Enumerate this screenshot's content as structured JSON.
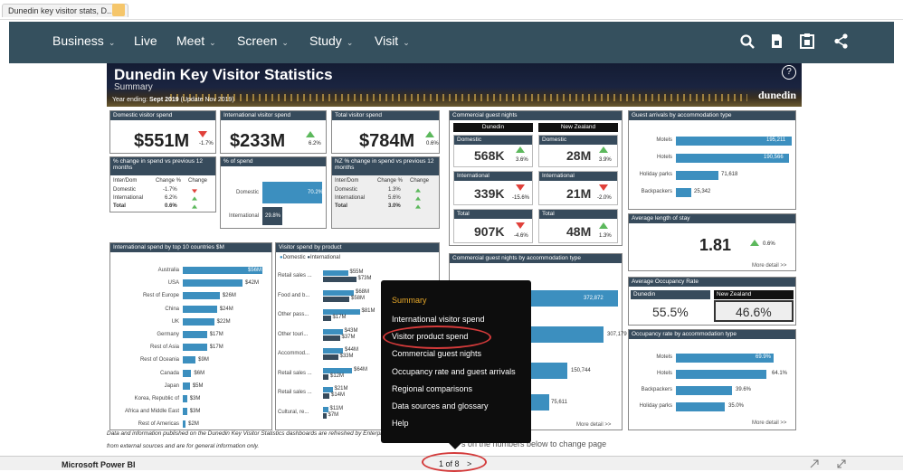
{
  "tab": {
    "title": "Dunedin key visitor stats, D...",
    "close": "×"
  },
  "nav": {
    "items": [
      "Business",
      "Live",
      "Meet",
      "Screen",
      "Study",
      "Visit"
    ],
    "chev": "⌄",
    "search": "🔍",
    "doc": "▪",
    "clip": "▣",
    "share": "<"
  },
  "banner": {
    "title": "Dunedin Key Visitor Statistics",
    "subtitle": "Summary",
    "date_prefix": "Year ending: ",
    "date_bold": "Sept 2019",
    "date_suffix": " (Update Nov 2019)",
    "logo": "dunedin",
    "help": "?"
  },
  "domestic": {
    "title": "Domestic visitor spend",
    "value": "$551M",
    "change": "-1.7%",
    "dir": "down"
  },
  "international": {
    "title": "International visitor spend",
    "value": "$233M",
    "change": "6.2%",
    "dir": "up"
  },
  "total": {
    "title": "Total visitor spend",
    "value": "$784M",
    "change": "0.6%",
    "dir": "up"
  },
  "change_table": {
    "title": "% change in spend vs previous 12 months",
    "headers": [
      "Inter/Dom",
      "Change %",
      "Change"
    ],
    "rows": [
      [
        "Domestic",
        "-1.7%"
      ],
      [
        "International",
        "6.2%"
      ],
      [
        "Total",
        "0.6%"
      ]
    ]
  },
  "pct_spend": {
    "title": "% of spend",
    "domestic_label": "Domestic",
    "domestic_val": "70.2%",
    "intl_label": "International",
    "intl_val": "29.8%"
  },
  "nz_change": {
    "title": "NZ % change in spend vs previous 12 months",
    "headers": [
      "Inter/Dom",
      "Change %",
      "Change"
    ],
    "rows": [
      [
        "Domestic",
        "1.3%"
      ],
      [
        "International",
        "5.6%"
      ],
      [
        "Total",
        "3.0%"
      ]
    ]
  },
  "guest_nights": {
    "title": "Commercial guest nights",
    "col1": "Dunedin",
    "col2": "New Zealand",
    "domestic_label": "Domestic",
    "intl_label": "International",
    "total_label": "Total",
    "d_dom": "568K",
    "d_dom_pct": "3.6%",
    "nz_dom": "28M",
    "nz_dom_pct": "3.9%",
    "d_int": "339K",
    "d_int_pct": "-15.6%",
    "nz_int": "21M",
    "nz_int_pct": "-2.0%",
    "d_tot": "907K",
    "d_tot_pct": "-4.6%",
    "nz_tot": "48M",
    "nz_tot_pct": "1.3%"
  },
  "arrivals": {
    "title": "Guest arrivals by accommodation type",
    "rows": [
      [
        "Motels",
        "195,211"
      ],
      [
        "Hotels",
        "190,566"
      ],
      [
        "Holiday parks",
        "71,618"
      ],
      [
        "Backpackers",
        "25,342"
      ]
    ]
  },
  "stay": {
    "title": "Average length of stay",
    "value": "1.81",
    "change": "0.6%",
    "more": "More detail >>"
  },
  "intl_countries": {
    "title": "International spend by top 10 countries $M",
    "rows": [
      [
        "Australia",
        "$56M"
      ],
      [
        "USA",
        "$42M"
      ],
      [
        "Rest of Europe",
        "$26M"
      ],
      [
        "China",
        "$24M"
      ],
      [
        "UK",
        "$22M"
      ],
      [
        "Germany",
        "$17M"
      ],
      [
        "Rest of Asia",
        "$17M"
      ],
      [
        "Rest of Oceania",
        "$9M"
      ],
      [
        "Canada",
        "$6M"
      ],
      [
        "Japan",
        "$5M"
      ],
      [
        "Korea, Republic of",
        "$3M"
      ],
      [
        "Africa and Middle East",
        "$3M"
      ],
      [
        "Rest of Americas",
        "$2M"
      ]
    ]
  },
  "by_product": {
    "title": "Visitor spend by product",
    "legend": [
      "Domestic",
      "International"
    ],
    "rows": [
      [
        "Retail sales ...",
        "$55M",
        "$73M"
      ],
      [
        "Food and b...",
        "$68M",
        "$58M"
      ],
      [
        "Other pass...",
        "$81M",
        "$17M"
      ],
      [
        "Other touri...",
        "$43M",
        "$37M"
      ],
      [
        "Accommod...",
        "$44M",
        "$33M"
      ],
      [
        "Retail sales ...",
        "$64M",
        "$12M"
      ],
      [
        "Retail sales ...",
        "$21M",
        "$14M"
      ],
      [
        "Cultural, re...",
        "$11M",
        "$7M"
      ]
    ]
  },
  "gn_by_type": {
    "title": "Commercial guest nights by accommodation type",
    "vals": [
      "372,872",
      "307,179",
      "150,744",
      "75,611"
    ],
    "more": "More detail >>"
  },
  "occupancy": {
    "title": "Average Occupancy Rate",
    "col1": "Dunedin",
    "col2": "New Zealand",
    "v1": "55.5%",
    "v2": "46.6%"
  },
  "occ_type": {
    "title": "Occupancy rate by accommodation type",
    "rows": [
      [
        "Motels",
        "69.9%"
      ],
      [
        "Hotels",
        "64.1%"
      ],
      [
        "Backpackers",
        "39.6%"
      ],
      [
        "Holiday parks",
        "35.0%"
      ]
    ],
    "more": "More detail >>"
  },
  "popup": {
    "items": [
      "Summary",
      "International visitor spend",
      "Visitor product spend",
      "Commercial guest nights",
      "Occupancy rate and guest arrivals",
      "Regional comparisons",
      "Data sources and glossary",
      "Help"
    ]
  },
  "footer": {
    "note1": "Data and information published on the Dunedin Key Visitor Statistics dashboards are refreshed by Enterprise",
    "note2": "from external sources and are for general information only.",
    "hint": "s on the numbers below to change page",
    "app": "Microsoft Power BI",
    "pager": "1 of 8",
    "next": ">"
  }
}
